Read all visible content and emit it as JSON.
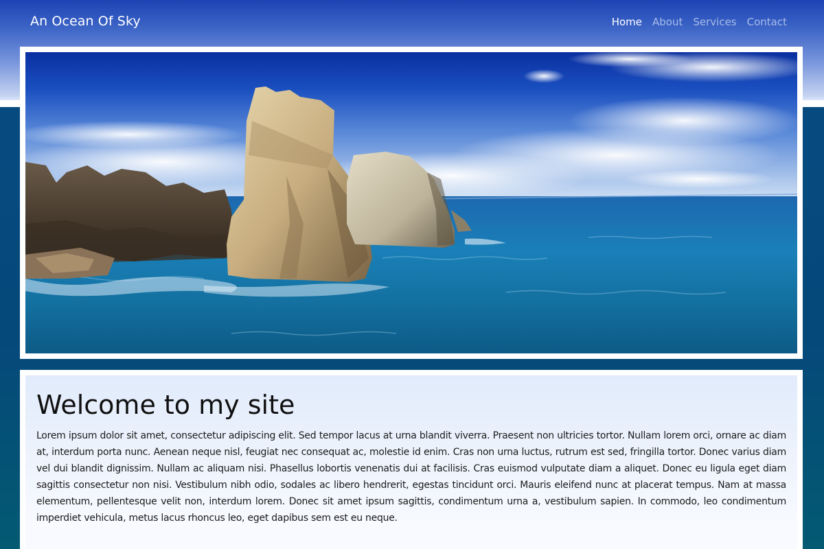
{
  "header": {
    "site_title": "An Ocean Of Sky"
  },
  "nav": {
    "items": [
      {
        "label": "Home",
        "active": true
      },
      {
        "label": "About",
        "active": false
      },
      {
        "label": "Services",
        "active": false
      },
      {
        "label": "Contact",
        "active": false
      }
    ]
  },
  "main": {
    "heading": "Welcome to my site",
    "body": "Lorem ipsum dolor sit amet, consectetur adipiscing elit. Sed tempor lacus at urna blandit viverra. Praesent non ultricies tortor. Nullam lorem orci, ornare ac diam at, interdum porta nunc. Aenean neque nisl, feugiat nec consequat ac, molestie id enim. Cras non urna luctus, rutrum est sed, fringilla tortor. Donec varius diam vel dui blandit dignissim. Nullam ac aliquam nisi. Phasellus lobortis venenatis dui at facilisis. Cras euismod vulputate diam a aliquet. Donec eu ligula eget diam sagittis consectetur non nisi. Vestibulum nibh odio, sodales ac libero hendrerit, egestas tincidunt orci. Mauris eleifend nunc at placerat tempus. Nam at massa elementum, pellentesque velit non, interdum lorem. Donec sit amet ipsum sagittis, condimentum urna a, vestibulum sapien. In commodo, leo condimentum imperdiet vehicula, metus lacus rhoncus leo, eget dapibus sem est eu neque."
  },
  "colors": {
    "header_top": "#1d43b4",
    "page_background": "#064a80",
    "nav_active": "#ffffff",
    "nav_inactive": "#a9bde9"
  }
}
